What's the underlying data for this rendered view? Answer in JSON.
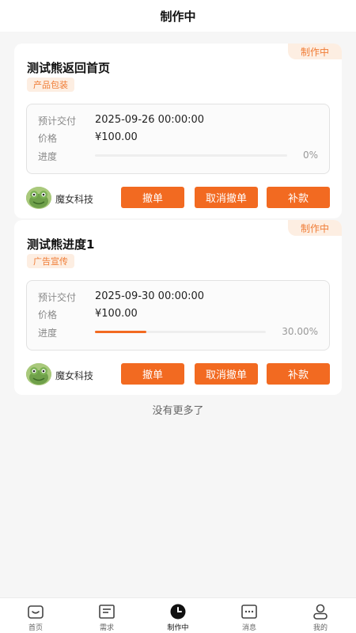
{
  "header": {
    "title": "制作中"
  },
  "orders": [
    {
      "status": "制作中",
      "title": "测试熊返回首页",
      "category": "产品包装",
      "delivery_label": "预计交付",
      "delivery_value": "2025-09-26 00:00:00",
      "price_label": "价格",
      "price_value": "¥100.00",
      "progress_label": "进度",
      "progress_text": "0%",
      "progress": 0,
      "company": "魔女科技",
      "buttons": {
        "withdraw": "撤单",
        "cancel_withdraw": "取消撤单",
        "supplement": "补款"
      }
    },
    {
      "status": "制作中",
      "title": "测试熊进度1",
      "category": "广告宣传",
      "delivery_label": "预计交付",
      "delivery_value": "2025-09-30 00:00:00",
      "price_label": "价格",
      "price_value": "¥100.00",
      "progress_label": "进度",
      "progress_text": "30.00%",
      "progress": 0.3,
      "company": "魔女科技",
      "buttons": {
        "withdraw": "撤单",
        "cancel_withdraw": "取消撤单",
        "supplement": "补款"
      }
    }
  ],
  "footer_note": "没有更多了",
  "tabbar": {
    "items": [
      {
        "label": "首页",
        "icon": "home-icon"
      },
      {
        "label": "需求",
        "icon": "document-icon"
      },
      {
        "label": "制作中",
        "icon": "clock-icon",
        "active": true
      },
      {
        "label": "消息",
        "icon": "chat-icon"
      },
      {
        "label": "我的",
        "icon": "user-icon"
      }
    ]
  },
  "colors": {
    "accent": "#f26a21",
    "tag_bg": "#fdeee2",
    "tag_text": "#f07c35"
  }
}
